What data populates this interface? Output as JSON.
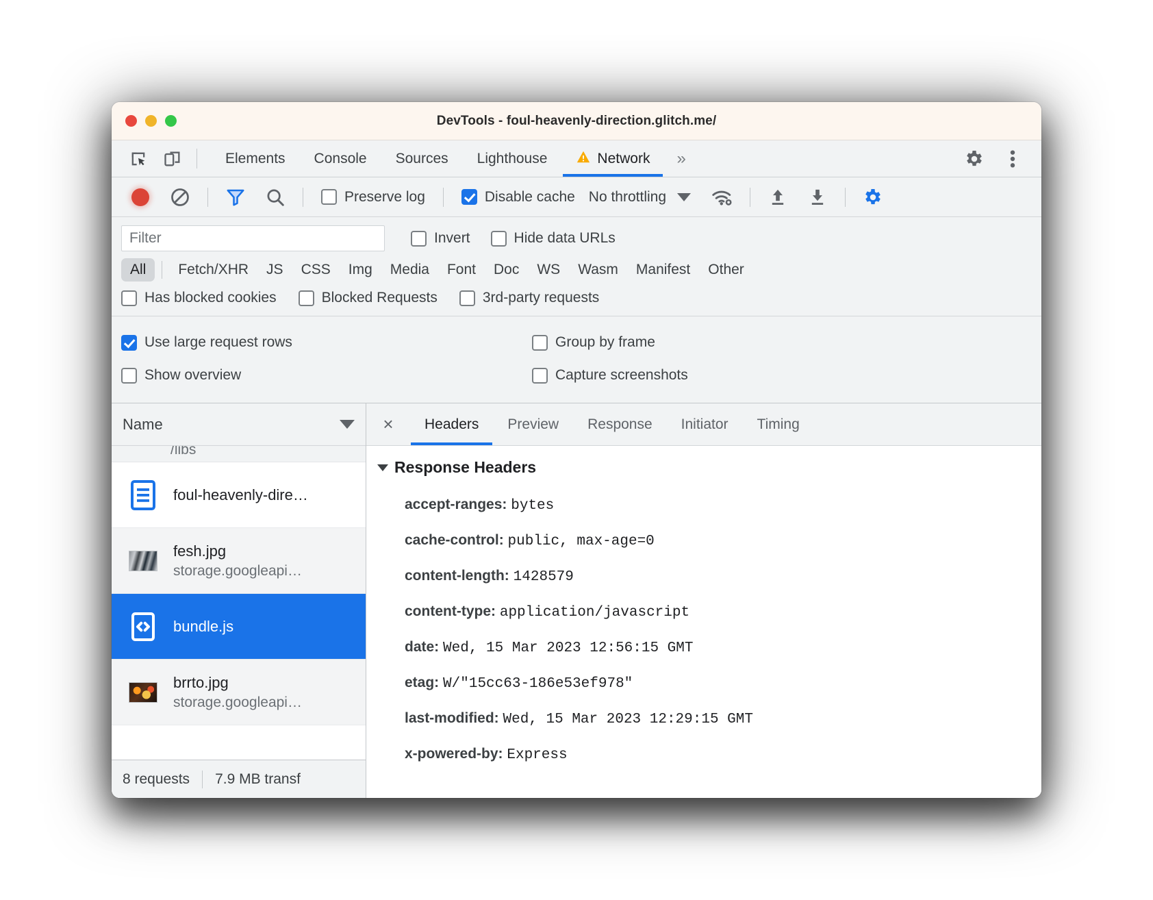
{
  "window": {
    "title": "DevTools - foul-heavenly-direction.glitch.me/"
  },
  "tabbar": {
    "tabs": [
      {
        "label": "Elements",
        "active": false
      },
      {
        "label": "Console",
        "active": false
      },
      {
        "label": "Sources",
        "active": false
      },
      {
        "label": "Lighthouse",
        "active": false
      },
      {
        "label": "Network",
        "active": true,
        "warning": true
      }
    ],
    "more": "»",
    "icons": [
      "inspect-element-icon",
      "device-toolbar-icon",
      "settings-gear-icon",
      "more-options-icon"
    ]
  },
  "network_toolbar": {
    "record_label": "record-button",
    "clear_label": "clear-button",
    "filter_icon": "filter-icon",
    "search_icon": "search-icon",
    "preserve_log": {
      "label": "Preserve log",
      "checked": false
    },
    "disable_cache": {
      "label": "Disable cache",
      "checked": true
    },
    "throttling": {
      "value": "No throttling"
    },
    "wifi_icon": "network-conditions-icon",
    "import_icon": "import-har-icon",
    "export_icon": "export-har-icon",
    "settings_icon": "network-settings-gear-icon"
  },
  "filter": {
    "placeholder": "Filter",
    "value": "",
    "invert": {
      "label": "Invert",
      "checked": false
    },
    "hide_data_urls": {
      "label": "Hide data URLs",
      "checked": false
    },
    "types": [
      {
        "label": "All",
        "selected": true
      },
      {
        "label": "Fetch/XHR",
        "selected": false
      },
      {
        "label": "JS",
        "selected": false
      },
      {
        "label": "CSS",
        "selected": false
      },
      {
        "label": "Img",
        "selected": false
      },
      {
        "label": "Media",
        "selected": false
      },
      {
        "label": "Font",
        "selected": false
      },
      {
        "label": "Doc",
        "selected": false
      },
      {
        "label": "WS",
        "selected": false
      },
      {
        "label": "Wasm",
        "selected": false
      },
      {
        "label": "Manifest",
        "selected": false
      },
      {
        "label": "Other",
        "selected": false
      }
    ],
    "flags": [
      {
        "label": "Has blocked cookies",
        "checked": false
      },
      {
        "label": "Blocked Requests",
        "checked": false
      },
      {
        "label": "3rd-party requests",
        "checked": false
      }
    ]
  },
  "settings_pane": {
    "use_large_request_rows": {
      "label": "Use large request rows",
      "checked": true
    },
    "group_by_frame": {
      "label": "Group by frame",
      "checked": false
    },
    "show_overview": {
      "label": "Show overview",
      "checked": false
    },
    "capture_screenshots": {
      "label": "Capture screenshots",
      "checked": false
    }
  },
  "request_list": {
    "column_header": "Name",
    "partial_top_row": "/libs",
    "rows": [
      {
        "name": "foul-heavenly-dire…",
        "sub": "",
        "icon": "document-icon",
        "selected": false
      },
      {
        "name": "fesh.jpg",
        "sub": "storage.googleapi…",
        "icon": "image-thumbnail-fish",
        "selected": false
      },
      {
        "name": "bundle.js",
        "sub": "",
        "icon": "script-icon",
        "selected": true
      },
      {
        "name": "brrto.jpg",
        "sub": "storage.googleapi…",
        "icon": "image-thumbnail-food",
        "selected": false
      }
    ],
    "status": {
      "requests": "8 requests",
      "transferred": "7.9 MB transf"
    }
  },
  "detail_panel": {
    "close": "×",
    "tabs": [
      {
        "label": "Headers",
        "active": true
      },
      {
        "label": "Preview",
        "active": false
      },
      {
        "label": "Response",
        "active": false
      },
      {
        "label": "Initiator",
        "active": false
      },
      {
        "label": "Timing",
        "active": false
      }
    ],
    "section_title": "Response Headers",
    "headers": [
      {
        "key": "accept-ranges:",
        "value": "bytes"
      },
      {
        "key": "cache-control:",
        "value": "public, max-age=0"
      },
      {
        "key": "content-length:",
        "value": "1428579"
      },
      {
        "key": "content-type:",
        "value": "application/javascript"
      },
      {
        "key": "date:",
        "value": "Wed, 15 Mar 2023 12:56:15 GMT"
      },
      {
        "key": "etag:",
        "value": "W/\"15cc63-186e53ef978\""
      },
      {
        "key": "last-modified:",
        "value": "Wed, 15 Mar 2023 12:29:15 GMT"
      },
      {
        "key": "x-powered-by:",
        "value": "Express"
      }
    ]
  },
  "colors": {
    "accent": "#1a73e8",
    "warning": "#f9ab00",
    "record": "#db4437",
    "chrome_bg": "#f1f3f4"
  }
}
